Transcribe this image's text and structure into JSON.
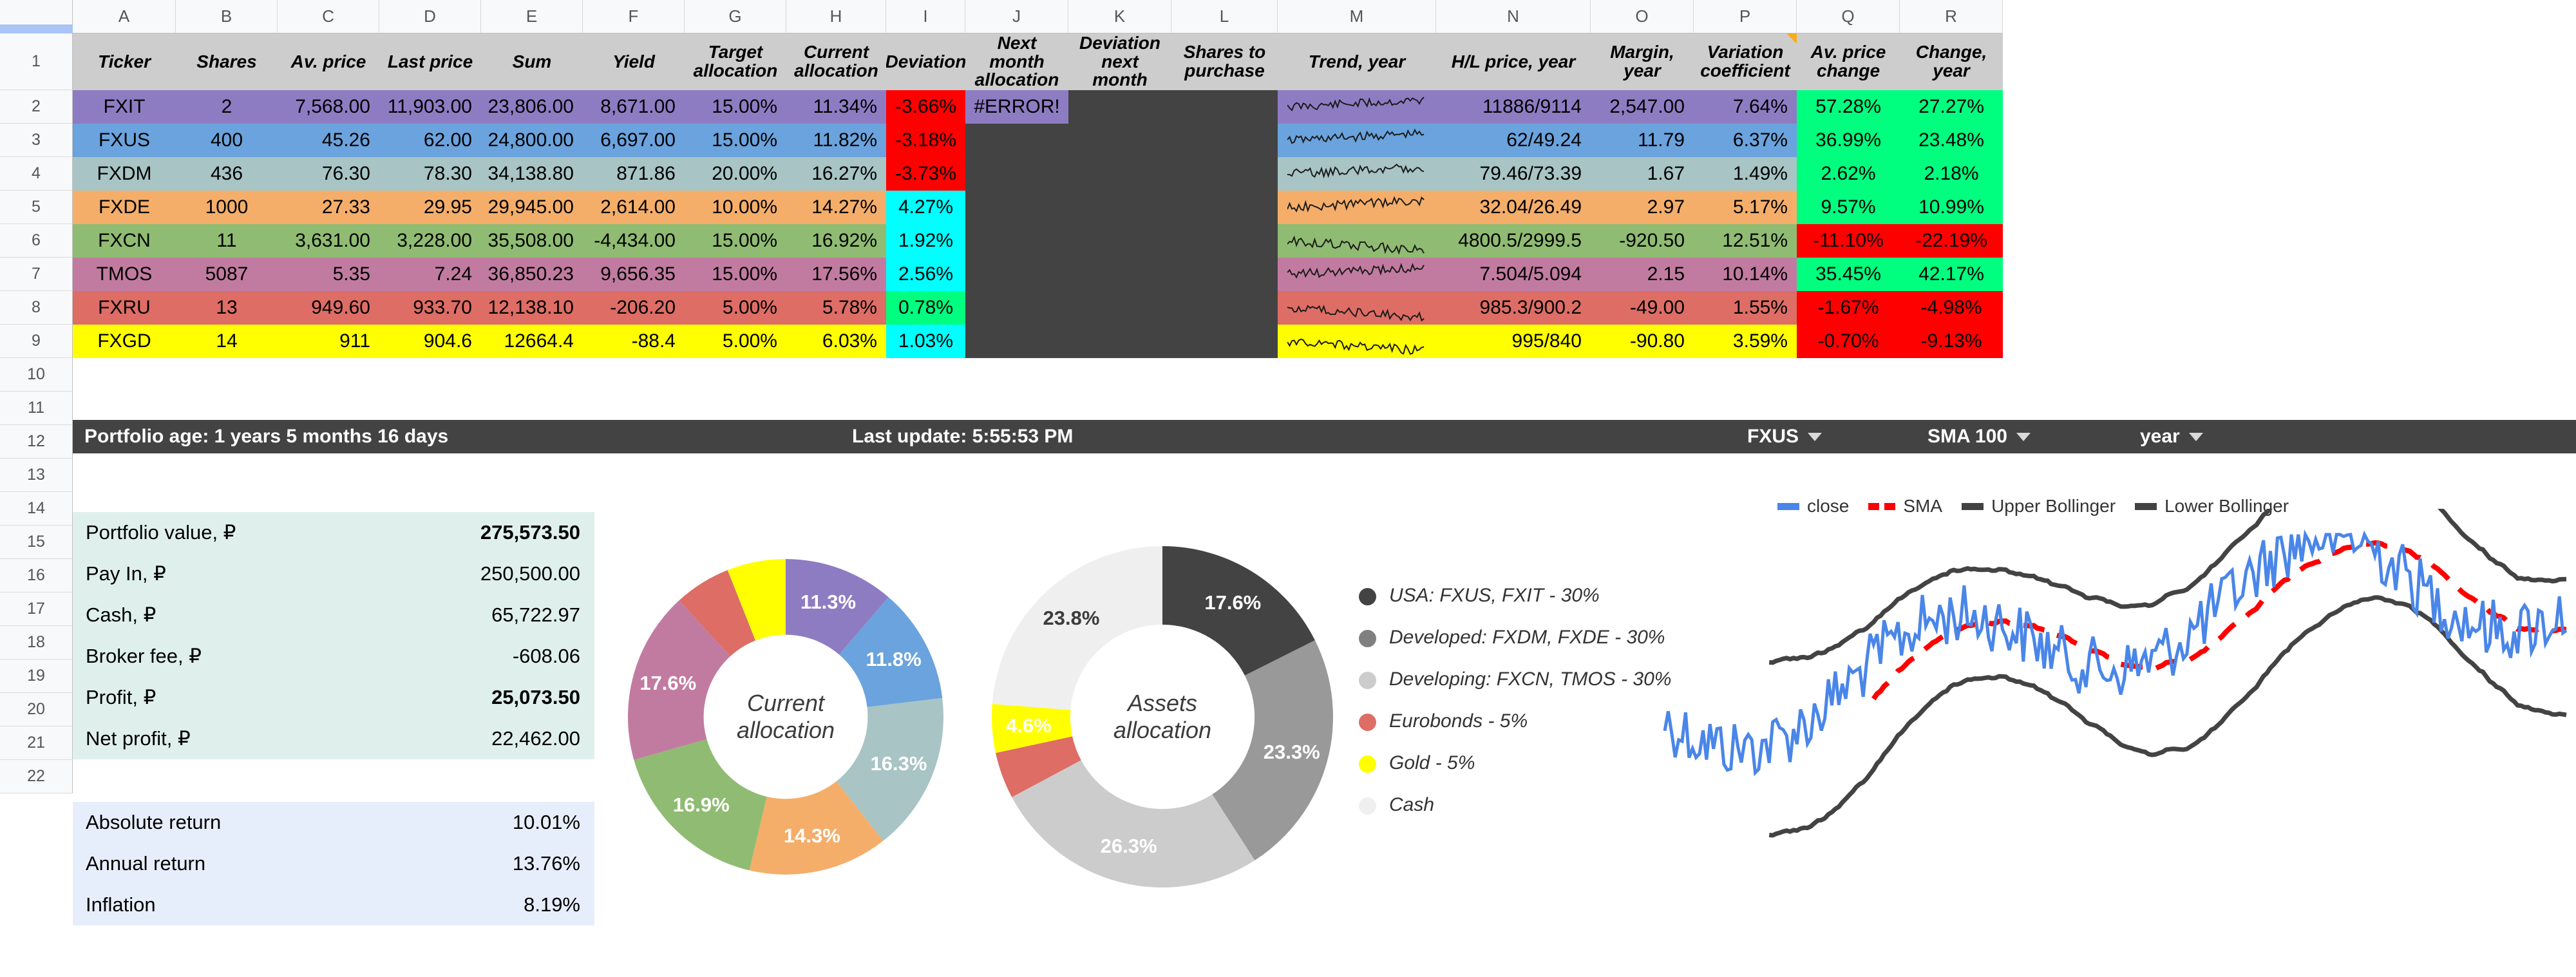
{
  "grid": {
    "columns": [
      "A",
      "B",
      "C",
      "D",
      "E",
      "F",
      "G",
      "H",
      "I",
      "J",
      "K",
      "L",
      "M",
      "N",
      "O",
      "P",
      "Q",
      "R"
    ],
    "rows": [
      "1",
      "2",
      "3",
      "4",
      "5",
      "6",
      "7",
      "8",
      "9",
      "10",
      "11",
      "12",
      "13",
      "14",
      "15",
      "16",
      "17",
      "18",
      "19",
      "20",
      "21",
      "22"
    ]
  },
  "table": {
    "headers": [
      "Ticker",
      "Shares",
      "Av. price",
      "Last price",
      "Sum",
      "Yield",
      "Target allocation",
      "Current allocation",
      "Deviation",
      "Next month allocation",
      "Deviation next month",
      "Shares to purchase",
      "Trend, year",
      "H/L price, year",
      "Margin, year",
      "Variation coefficient",
      "Av. price change",
      "Change, year"
    ],
    "rows": [
      {
        "ticker": "FXIT",
        "shares": "2",
        "av_price": "7,568.00",
        "last_price": "11,903.00",
        "sum": "23,806.00",
        "yield": "8,671.00",
        "target": "15.00%",
        "current": "11.34%",
        "deviation": "-3.66%",
        "next_month": "#ERROR!",
        "dev_next": "",
        "shares_buy": "",
        "hl": "11886/9114",
        "margin": "2,547.00",
        "varcoef": "7.64%",
        "avchange": "57.28%",
        "change": "27.27%",
        "row_color": "#8e7cc3",
        "dev_color": "#ff0000",
        "chg_color": "#00ff7f"
      },
      {
        "ticker": "FXUS",
        "shares": "400",
        "av_price": "45.26",
        "last_price": "62.00",
        "sum": "24,800.00",
        "yield": "6,697.00",
        "target": "15.00%",
        "current": "11.82%",
        "deviation": "-3.18%",
        "next_month": "",
        "dev_next": "",
        "shares_buy": "",
        "hl": "62/49.24",
        "margin": "11.79",
        "varcoef": "6.37%",
        "avchange": "36.99%",
        "change": "23.48%",
        "row_color": "#6aa3dd",
        "dev_color": "#ff0000",
        "chg_color": "#00ff7f"
      },
      {
        "ticker": "FXDM",
        "shares": "436",
        "av_price": "76.30",
        "last_price": "78.30",
        "sum": "34,138.80",
        "yield": "871.86",
        "target": "20.00%",
        "current": "16.27%",
        "deviation": "-3.73%",
        "next_month": "",
        "dev_next": "",
        "shares_buy": "",
        "hl": "79.46/73.39",
        "margin": "1.67",
        "varcoef": "1.49%",
        "avchange": "2.62%",
        "change": "2.18%",
        "row_color": "#a8c4c4",
        "dev_color": "#ff0000",
        "chg_color": "#00ff7f"
      },
      {
        "ticker": "FXDE",
        "shares": "1000",
        "av_price": "27.33",
        "last_price": "29.95",
        "sum": "29,945.00",
        "yield": "2,614.00",
        "target": "10.00%",
        "current": "14.27%",
        "deviation": "4.27%",
        "next_month": "",
        "dev_next": "",
        "shares_buy": "",
        "hl": "32.04/26.49",
        "margin": "2.97",
        "varcoef": "5.17%",
        "avchange": "9.57%",
        "change": "10.99%",
        "row_color": "#f4ae6a",
        "dev_color": "#00ffff",
        "chg_color": "#00ff7f"
      },
      {
        "ticker": "FXCN",
        "shares": "11",
        "av_price": "3,631.00",
        "last_price": "3,228.00",
        "sum": "35,508.00",
        "yield": "-4,434.00",
        "target": "15.00%",
        "current": "16.92%",
        "deviation": "1.92%",
        "next_month": "",
        "dev_next": "",
        "shares_buy": "",
        "hl": "4800.5/2999.5",
        "margin": "-920.50",
        "varcoef": "12.51%",
        "avchange": "-11.10%",
        "change": "-22.19%",
        "row_color": "#8fbc72",
        "dev_color": "#00ffff",
        "chg_color": "#ff0000"
      },
      {
        "ticker": "TMOS",
        "shares": "5087",
        "av_price": "5.35",
        "last_price": "7.24",
        "sum": "36,850.23",
        "yield": "9,656.35",
        "target": "15.00%",
        "current": "17.56%",
        "deviation": "2.56%",
        "next_month": "",
        "dev_next": "",
        "shares_buy": "",
        "hl": "7.504/5.094",
        "margin": "2.15",
        "varcoef": "10.14%",
        "avchange": "35.45%",
        "change": "42.17%",
        "row_color": "#c27ba0",
        "dev_color": "#00ffff",
        "chg_color": "#00ff7f"
      },
      {
        "ticker": "FXRU",
        "shares": "13",
        "av_price": "949.60",
        "last_price": "933.70",
        "sum": "12,138.10",
        "yield": "-206.20",
        "target": "5.00%",
        "current": "5.78%",
        "deviation": "0.78%",
        "next_month": "",
        "dev_next": "",
        "shares_buy": "",
        "hl": "985.3/900.2",
        "margin": "-49.00",
        "varcoef": "1.55%",
        "avchange": "-1.67%",
        "change": "-4.98%",
        "row_color": "#dd6d65",
        "dev_color": "#00ff7f",
        "chg_color": "#ff0000"
      },
      {
        "ticker": "FXGD",
        "shares": "14",
        "av_price": "911",
        "last_price": "904.6",
        "sum": "12664.4",
        "yield": "-88.4",
        "target": "5.00%",
        "current": "6.03%",
        "deviation": "1.03%",
        "next_month": "",
        "dev_next": "",
        "shares_buy": "",
        "hl": "995/840",
        "margin": "-90.80",
        "varcoef": "3.59%",
        "avchange": "-0.70%",
        "change": "-9.13%",
        "row_color": "#ffff00",
        "dev_color": "#00ffff",
        "chg_color": "#ff0000"
      }
    ]
  },
  "statusbar": {
    "portfolio_age": "Portfolio age: 1 years 5 months 16 days",
    "last_update": "Last update: 5:55:53 PM",
    "ticker_select": "FXUS",
    "sma_select": "SMA 100",
    "period_select": "year"
  },
  "summary": {
    "rows": [
      {
        "label": "Portfolio value, ₽",
        "value": "275,573.50",
        "bold": true
      },
      {
        "label": "Pay In, ₽",
        "value": "250,500.00",
        "bold": false
      },
      {
        "label": "Cash, ₽",
        "value": "65,722.97",
        "bold": false
      },
      {
        "label": "Broker fee, ₽",
        "value": "-608.06",
        "bold": false
      },
      {
        "label": "Profit, ₽",
        "value": "25,073.50",
        "bold": true
      },
      {
        "label": "Net profit, ₽",
        "value": "22,462.00",
        "bold": false
      }
    ]
  },
  "returns": {
    "rows": [
      {
        "label": "Absolute return",
        "value": "10.01%"
      },
      {
        "label": "Annual return",
        "value": "13.76%"
      },
      {
        "label": "Inflation",
        "value": "8.19%"
      }
    ]
  },
  "chart_data": [
    {
      "type": "pie",
      "title": "Current allocation",
      "categories": [
        "FXIT",
        "FXUS",
        "FXDM",
        "FXDE",
        "FXCN",
        "TMOS",
        "FXRU",
        "FXGD"
      ],
      "values": [
        11.3,
        11.8,
        16.3,
        14.3,
        16.9,
        17.6,
        5.8,
        6.0
      ],
      "labels": [
        "11.3%",
        "11.8%",
        "16.3%",
        "14.3%",
        "16.9%",
        "17.6%",
        "",
        "6.0%"
      ],
      "colors": [
        "#8e7cc3",
        "#6aa3dd",
        "#a8c4c4",
        "#f4ae6a",
        "#8fbc72",
        "#c27ba0",
        "#dd6d65",
        "#ffff00"
      ],
      "legend": "none"
    },
    {
      "type": "pie",
      "title": "Assets allocation",
      "categories": [
        "USA: FXUS, FXIT - 30%",
        "Developed: FXDM, FXDE - 30%",
        "Developing: FXCN, TMOS - 30%",
        "Eurobonds - 5%",
        "Gold - 5%",
        "Cash"
      ],
      "values": [
        17.6,
        23.3,
        26.3,
        4.4,
        4.6,
        23.8
      ],
      "labels": [
        "17.6%",
        "23.3%",
        "26.3%",
        "",
        "4.6%",
        "23.8%"
      ],
      "colors": [
        "#434343",
        "#999999",
        "#cccccc",
        "#dd6d65",
        "#ffff00",
        "#efefef"
      ],
      "legend": "right"
    },
    {
      "type": "line",
      "title": "",
      "xlabel": "",
      "ylabel": "",
      "legend": "top",
      "series": [
        {
          "name": "close",
          "color": "#4a86e8",
          "style": "solid"
        },
        {
          "name": "SMA",
          "color": "#ff0000",
          "style": "dashed"
        },
        {
          "name": "Upper Bollinger",
          "color": "#434343",
          "style": "solid"
        },
        {
          "name": "Lower Bollinger",
          "color": "#434343",
          "style": "solid"
        }
      ]
    }
  ],
  "legend_items": [
    {
      "label": "USA: FXUS, FXIT - 30%",
      "color": "#434343"
    },
    {
      "label": "Developed: FXDM, FXDE - 30%",
      "color": "#808080"
    },
    {
      "label": "Developing: FXCN, TMOS - 30%",
      "color": "#cccccc"
    },
    {
      "label": "Eurobonds - 5%",
      "color": "#dd6d65"
    },
    {
      "label": "Gold - 5%",
      "color": "#ffff00"
    },
    {
      "label": "Cash",
      "color": "#efefef"
    }
  ],
  "chart_legend": [
    {
      "label": "close",
      "color": "#4a86e8",
      "dashed": false
    },
    {
      "label": "SMA",
      "color": "#ff0000",
      "dashed": true
    },
    {
      "label": "Upper Bollinger",
      "color": "#434343",
      "dashed": false
    },
    {
      "label": "Lower Bollinger",
      "color": "#434343",
      "dashed": false
    }
  ]
}
